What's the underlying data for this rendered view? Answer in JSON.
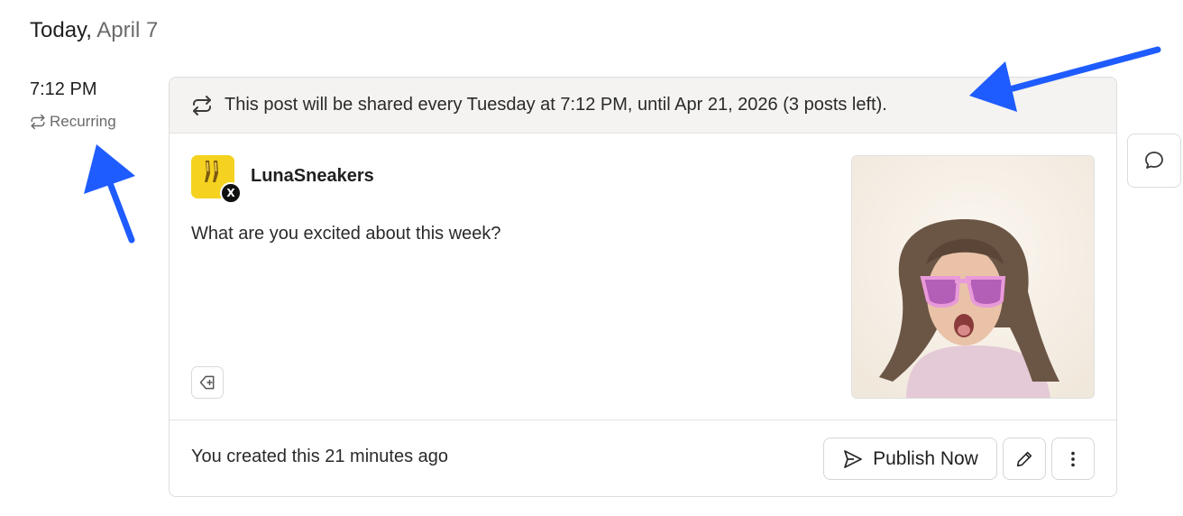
{
  "day": {
    "today": "Today,",
    "date": "April 7"
  },
  "slot": {
    "time": "7:12 PM",
    "recurring_label": "Recurring"
  },
  "post": {
    "banner_text": "This post will be shared every Tuesday at 7:12 PM, until Apr 21, 2026 (3 posts left).",
    "account_name": "LunaSneakers",
    "network": "X",
    "text": "What are you excited about this week?",
    "created_text": "You created this 21 minutes ago",
    "publish_label": "Publish Now"
  },
  "colors": {
    "annotation_arrow": "#1f5cff",
    "avatar_bg": "#f4d21f",
    "banner_bg": "#f4f3f1"
  },
  "icons": [
    "repeat-icon",
    "tag-add-icon",
    "send-icon",
    "pencil-icon",
    "more-vertical-icon",
    "comment-icon",
    "x-logo-icon"
  ]
}
